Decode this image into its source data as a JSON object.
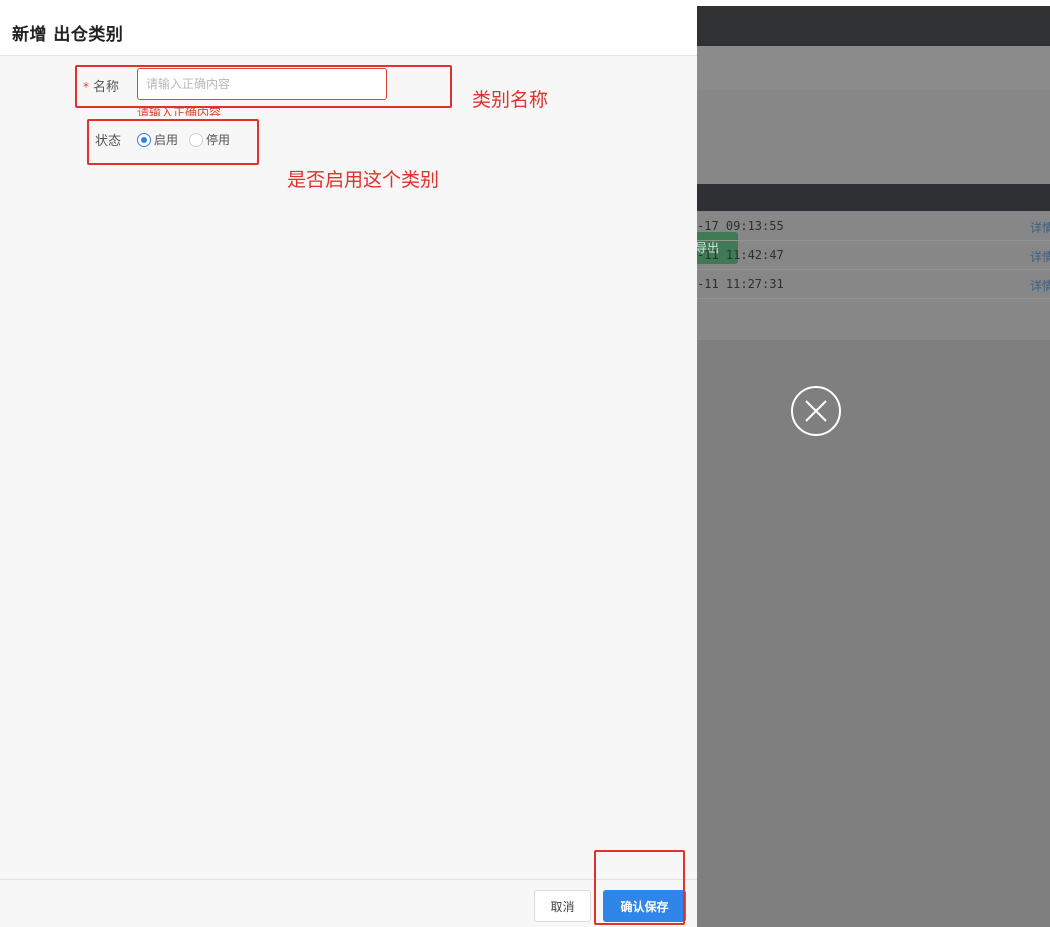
{
  "drawer": {
    "title": "新增 出仓类别"
  },
  "form": {
    "name": {
      "required_mark": "*",
      "label": "名称",
      "placeholder": "请输入正确内容",
      "value": "",
      "error": "请输入正确内容"
    },
    "status": {
      "label": "状态",
      "options": [
        {
          "label": "启用",
          "checked": true
        },
        {
          "label": "停用",
          "checked": false
        }
      ]
    }
  },
  "annotations": {
    "name_note": "类别名称",
    "status_note": "是否启用这个类别"
  },
  "footer": {
    "cancel_label": "取消",
    "save_label": "确认保存"
  },
  "background": {
    "export_label": "导出",
    "rows": [
      {
        "time": "-17 09:13:55",
        "action": "详情"
      },
      {
        "time": "-11 11:42:47",
        "action": "详情"
      },
      {
        "time": "-11 11:27:31",
        "action": "详情"
      }
    ]
  },
  "colors": {
    "primary": "#2f86e8",
    "error": "#e0453a",
    "annotation": "#e0322a",
    "mask": "#7f7f7f"
  }
}
